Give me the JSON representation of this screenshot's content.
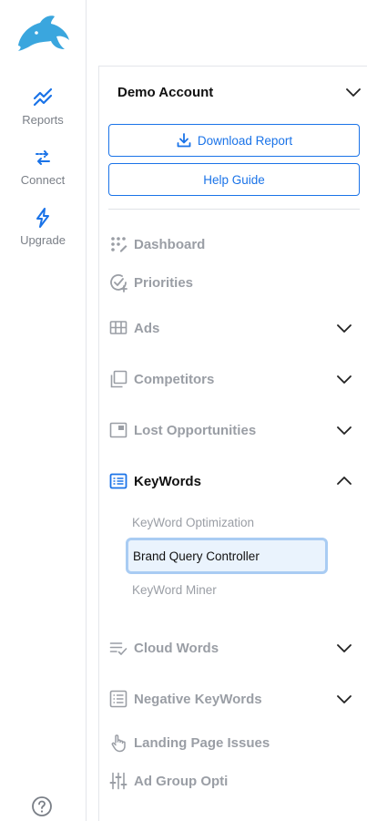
{
  "rail": {
    "items": [
      {
        "label": "Reports",
        "icon": "reports-chart-icon"
      },
      {
        "label": "Connect",
        "icon": "connect-arrows-icon"
      },
      {
        "label": "Upgrade",
        "icon": "lightning-icon"
      }
    ]
  },
  "account": {
    "name": "Demo Account"
  },
  "buttons": {
    "download": "Download Report",
    "help": "Help Guide"
  },
  "nav": {
    "dashboard": "Dashboard",
    "priorities": "Priorities",
    "ads": "Ads",
    "competitors": "Competitors",
    "lost": "Lost Opportunities",
    "keywords": "KeyWords",
    "cloud": "Cloud Words",
    "negative": "Negative KeyWords",
    "landing": "Landing Page Issues",
    "adgroup": "Ad Group Opti"
  },
  "keywords_sub": {
    "optimization": "KeyWord Optimization",
    "brand": "Brand Query Controller",
    "miner": "KeyWord Miner"
  },
  "colors": {
    "accent": "#1a73e8",
    "muted": "#9a9ea5",
    "active_bg": "#eaf3fd",
    "logo": "#3aa6de"
  }
}
